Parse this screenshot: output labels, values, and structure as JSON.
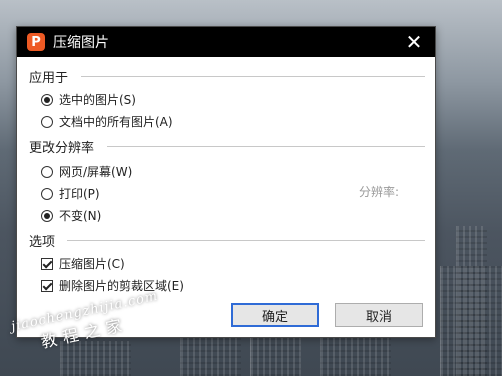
{
  "dialog": {
    "title": "压缩图片",
    "app_icon_glyph": "P",
    "close_glyph": "✕"
  },
  "sections": {
    "apply_to": {
      "label": "应用于",
      "options": [
        {
          "label": "选中的图片(S)",
          "checked": true
        },
        {
          "label": "文档中的所有图片(A)",
          "checked": false
        }
      ]
    },
    "resolution": {
      "label": "更改分辨率",
      "options": [
        {
          "label": "网页/屏幕(W)",
          "checked": false
        },
        {
          "label": "打印(P)",
          "checked": false
        },
        {
          "label": "不变(N)",
          "checked": true
        }
      ],
      "resolution_label": "分辨率:"
    },
    "options": {
      "label": "选项",
      "items": [
        {
          "label": "压缩图片(C)",
          "checked": true
        },
        {
          "label": "删除图片的剪裁区域(E)",
          "checked": true
        }
      ]
    }
  },
  "buttons": {
    "ok": "确定",
    "cancel": "取消"
  },
  "watermark": {
    "url": "jiaochengzhijia.com",
    "cn": "教程之家"
  },
  "colors": {
    "titlebar": "#000000",
    "app_icon": "#ee5a24",
    "primary_border": "#2f6bd6"
  }
}
